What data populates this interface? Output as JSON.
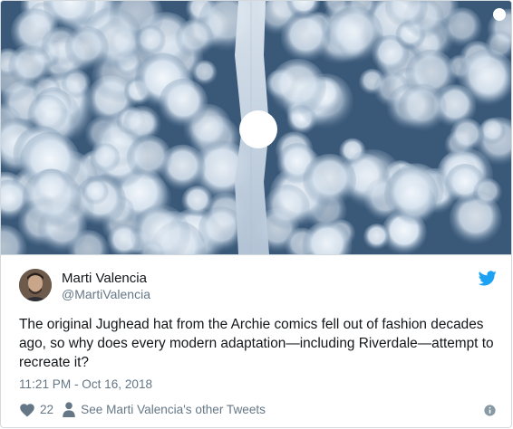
{
  "tweet": {
    "author": {
      "name": "Marti Valencia",
      "handle": "@MartiValencia"
    },
    "text": "The original Jughead hat from the Archie comics fell out of fashion decades ago, so why does every modern adaptation—including Riverdale—attempt to recreate it?",
    "timestamp": "11:21 PM - Oct 16, 2018",
    "likes": "22",
    "other_tweets_label": "See Marti Valencia's other Tweets"
  },
  "media": {
    "description_colors": {
      "forest": "#3d5d7c",
      "snow": "#eef3f8",
      "road": "#c9d6e3"
    }
  },
  "icons": {
    "brand": "twitter-bird-icon",
    "like": "heart-icon",
    "profile": "person-icon",
    "info": "info-icon"
  },
  "colors": {
    "text_primary": "#14171a",
    "text_secondary": "#657786",
    "brand": "#1da1f2",
    "border": "#d4d9de"
  }
}
